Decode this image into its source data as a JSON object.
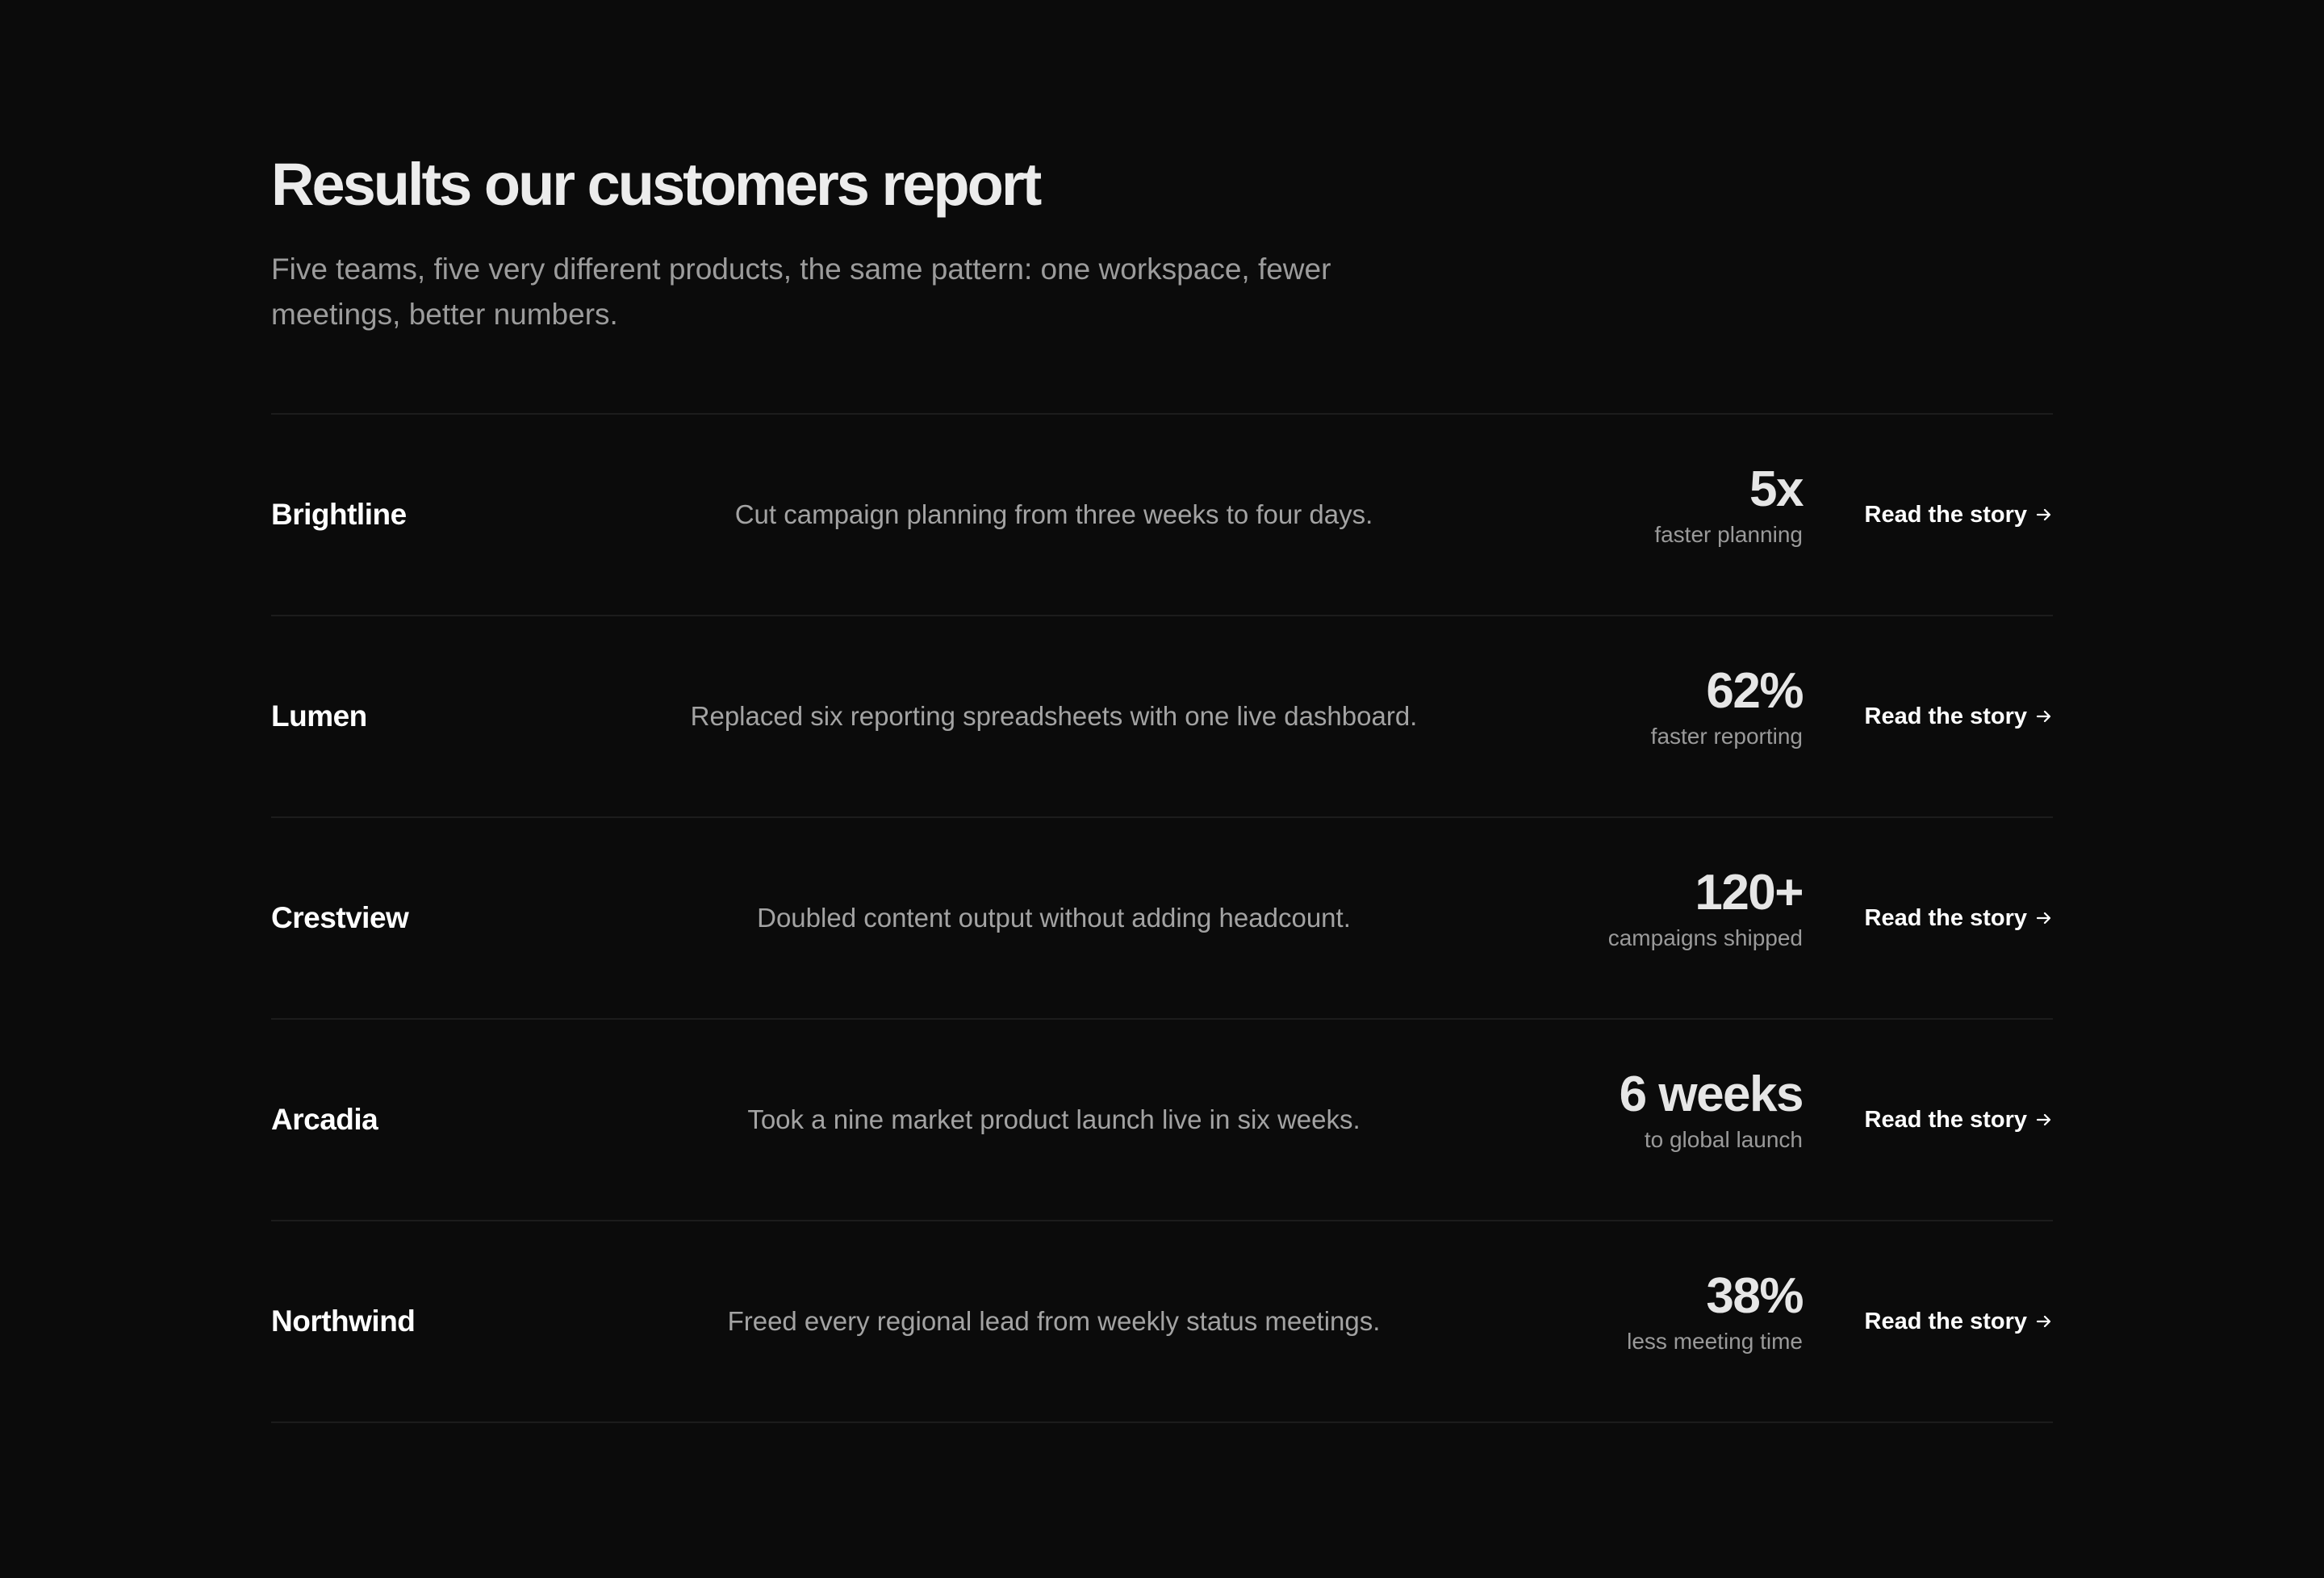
{
  "header": {
    "title": "Results our customers report",
    "subtitle": "Five teams, five very different products, the same pattern: one workspace, fewer meetings, better numbers."
  },
  "icons": {
    "link_arrow": "arrow-right-icon"
  },
  "colors": {
    "background": "#0b0b0b",
    "text_primary": "#ffffff",
    "text_muted": "#a3a3a3",
    "divider": "#1c1c1c"
  },
  "rows": [
    {
      "company": "Brightline",
      "summary": "Cut campaign planning from three weeks to four days.",
      "metric_value": "5x",
      "metric_label": "faster planning",
      "link_label": "Read the story"
    },
    {
      "company": "Lumen",
      "summary": "Replaced six reporting spreadsheets with one live dashboard.",
      "metric_value": "62%",
      "metric_label": "faster reporting",
      "link_label": "Read the story"
    },
    {
      "company": "Crestview",
      "summary": "Doubled content output without adding headcount.",
      "metric_value": "120+",
      "metric_label": "campaigns shipped",
      "link_label": "Read the story"
    },
    {
      "company": "Arcadia",
      "summary": "Took a nine market product launch live in six weeks.",
      "metric_value": "6 weeks",
      "metric_label": "to global launch",
      "link_label": "Read the story"
    },
    {
      "company": "Northwind",
      "summary": "Freed every regional lead from weekly status meetings.",
      "metric_value": "38%",
      "metric_label": "less meeting time",
      "link_label": "Read the story"
    }
  ]
}
